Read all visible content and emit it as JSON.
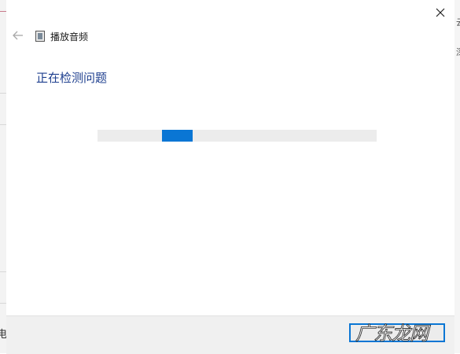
{
  "dialog": {
    "title": "播放音频",
    "heading": "正在检测问题",
    "progress": {
      "state": "indeterminate",
      "chunk_start_fraction": 0.23,
      "chunk_width_fraction": 0.11
    },
    "footer": {
      "button_label": ""
    }
  },
  "background": {
    "left_char": "电",
    "right_chars": [
      "云",
      "深"
    ]
  },
  "watermark": {
    "text": "广东龙网"
  },
  "colors": {
    "accent": "#0a76d4",
    "heading": "#1e3f8f",
    "track": "#ececec",
    "footer_bg": "#f0f0f0"
  },
  "icons": {
    "close": "close-icon",
    "back": "back-arrow-icon",
    "title": "troubleshooter-icon"
  }
}
